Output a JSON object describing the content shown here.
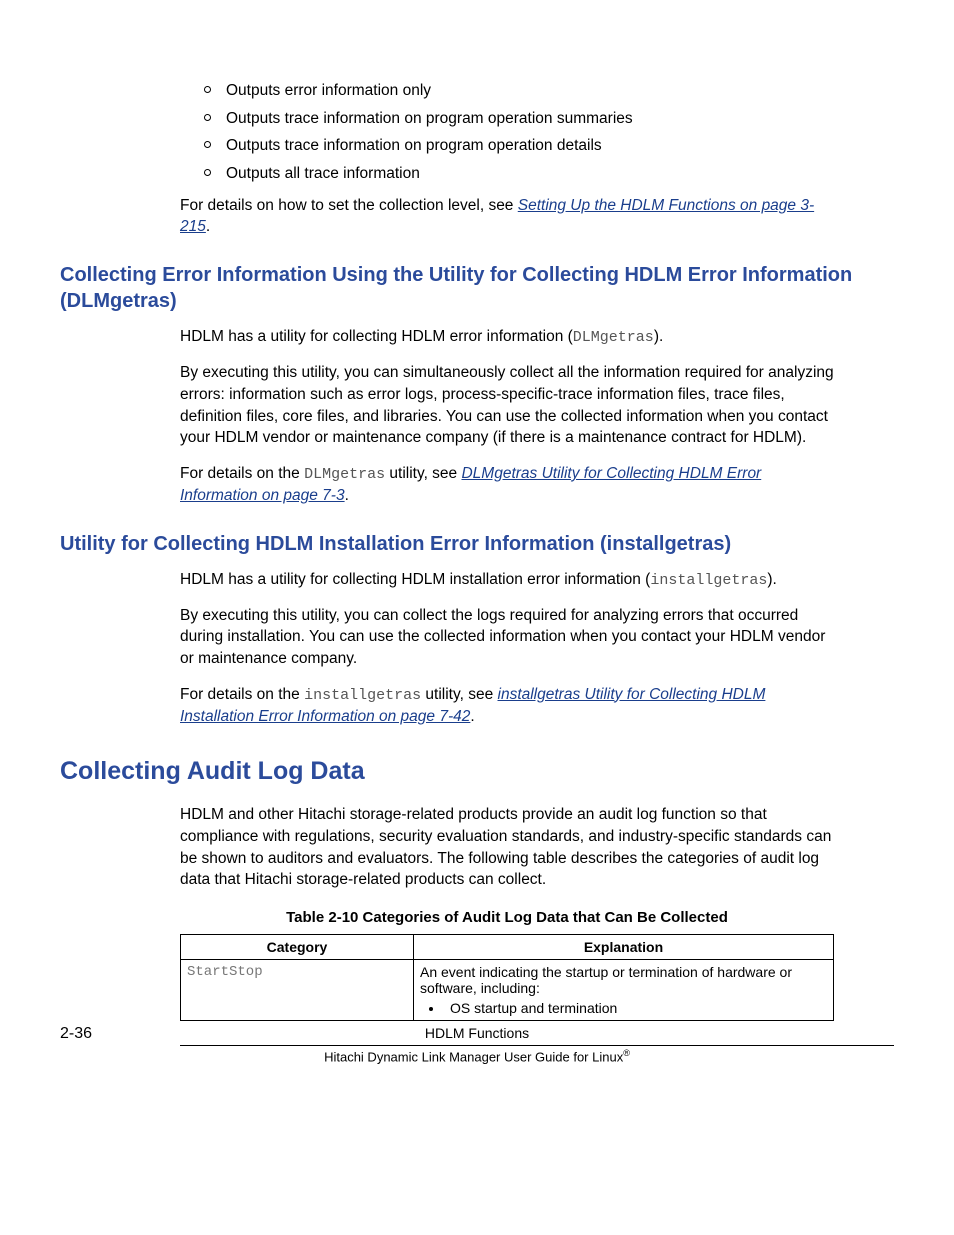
{
  "bullets": {
    "b1": "Outputs error information only",
    "b2": "Outputs trace information on program operation summaries",
    "b3": "Outputs trace information on program operation details",
    "b4": "Outputs all trace information"
  },
  "p1_pre": "For details on how to set the collection level, see ",
  "p1_link": "Setting Up the HDLM Functions on page 3-215",
  "period": ".",
  "h_dlmgetras": "Collecting Error Information Using the Utility for Collecting HDLM Error Information (DLMgetras)",
  "dlm_p1_a": "HDLM has a utility for collecting HDLM error information (",
  "dlm_p1_mono": "DLMgetras",
  "dlm_p1_b": ").",
  "dlm_p2": "By executing this utility, you can simultaneously collect all the information required for analyzing errors: information such as error logs, process-specific-trace information files, trace files, definition files, core files, and libraries. You can use the collected information when you contact your HDLM vendor or maintenance company (if there is a maintenance contract for HDLM).",
  "dlm_p3_a": "For details on the ",
  "dlm_p3_mono": "DLMgetras",
  "dlm_p3_b": " utility, see ",
  "dlm_p3_link": "DLMgetras Utility for Collecting HDLM Error Information on page 7-3",
  "h_installgetras": "Utility for Collecting HDLM Installation Error Information (installgetras)",
  "ins_p1_a": "HDLM has a utility for collecting HDLM installation error information (",
  "ins_p1_mono": "installgetras",
  "ins_p1_b": ").",
  "ins_p2": "By executing this utility, you can collect the logs required for analyzing errors that occurred during installation. You can use the collected information when you contact your HDLM vendor or maintenance company.",
  "ins_p3_a": "For details on the ",
  "ins_p3_mono": "installgetras",
  "ins_p3_b": " utility, see ",
  "ins_p3_link": "installgetras Utility for Collecting HDLM Installation Error Information on page 7-42",
  "h_audit": "Collecting Audit Log Data",
  "audit_p1": "HDLM and other Hitachi storage-related products provide an audit log function so that compliance with regulations, security evaluation standards, and industry-specific standards can be shown to auditors and evaluators. The following table describes the categories of audit log data that Hitachi storage-related products can collect.",
  "table_caption": "Table 2-10 Categories of Audit Log Data that Can Be Collected",
  "th1": "Category",
  "th2": "Explanation",
  "row1_cat": "StartStop",
  "row1_exp": "An event indicating the startup or termination of hardware or software, including:",
  "row1_li1": "OS startup and termination",
  "footer_page": "2-36",
  "footer_line1": "HDLM Functions",
  "footer_line2_a": "Hitachi Dynamic Link Manager User Guide for Linux",
  "footer_reg": "®"
}
